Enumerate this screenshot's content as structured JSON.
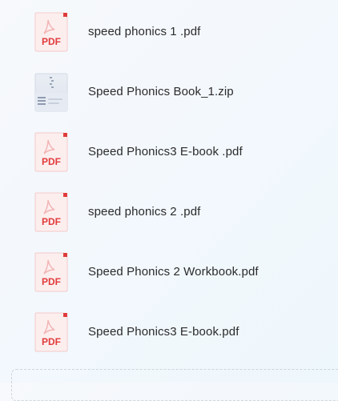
{
  "files": [
    {
      "name": "speed phonics 1 .pdf",
      "type": "pdf",
      "icon": "pdf-file-icon",
      "badge": "PDF"
    },
    {
      "name": "Speed Phonics Book_1.zip",
      "type": "zip",
      "icon": "zip-archive-icon"
    },
    {
      "name": "Speed Phonics3 E-book .pdf",
      "type": "pdf",
      "icon": "pdf-file-icon",
      "badge": "PDF"
    },
    {
      "name": "speed phonics 2 .pdf",
      "type": "pdf",
      "icon": "pdf-file-icon",
      "badge": "PDF"
    },
    {
      "name": "Speed Phonics 2 Workbook.pdf",
      "type": "pdf",
      "icon": "pdf-file-icon",
      "badge": "PDF"
    },
    {
      "name": "Speed Phonics3 E-book.pdf",
      "type": "pdf",
      "icon": "pdf-file-icon",
      "badge": "PDF"
    }
  ],
  "colors": {
    "pdf_red": "#e03b3b",
    "pdf_bg": "#fdeeee",
    "zip_gray": "#aeb8c8",
    "text": "#2b2b2b"
  }
}
